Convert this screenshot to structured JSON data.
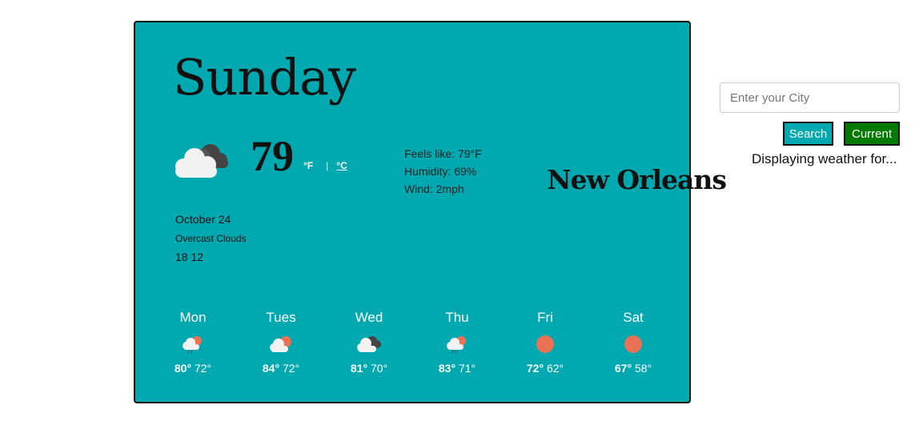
{
  "current": {
    "day": "Sunday",
    "icon": "overcast-clouds-icon",
    "temperature": "79",
    "unit_f": "°F",
    "unit_sep": "|",
    "unit_c": "°C",
    "feels_like": "Feels like: 79°F",
    "humidity": "Humidity: 69%",
    "wind": "Wind: 2mph",
    "date": "October 24",
    "description": "Overcast Clouds",
    "range": "18 12"
  },
  "forecast": [
    {
      "day": "Mon",
      "icon": "light-rain-icon",
      "high": "80°",
      "low": "72°"
    },
    {
      "day": "Tues",
      "icon": "partly-cloudy-icon",
      "high": "84°",
      "low": "72°"
    },
    {
      "day": "Wed",
      "icon": "overcast-clouds-icon",
      "high": "81°",
      "low": "70°"
    },
    {
      "day": "Thu",
      "icon": "light-rain-icon",
      "high": "83°",
      "low": "71°"
    },
    {
      "day": "Fri",
      "icon": "sun-icon",
      "high": "72°",
      "low": "62°"
    },
    {
      "day": "Sat",
      "icon": "sun-icon",
      "high": "67°",
      "low": "58°"
    }
  ],
  "search": {
    "placeholder": "Enter your City",
    "value": "",
    "search_label": "Search",
    "current_label": "Current",
    "displaying_text": "Displaying weather for...",
    "city": "New Orleans"
  },
  "colors": {
    "card_bg": "#00a9b0",
    "search_button": "#00a9b0",
    "current_button": "#007a00",
    "sun": "#ea7254"
  }
}
